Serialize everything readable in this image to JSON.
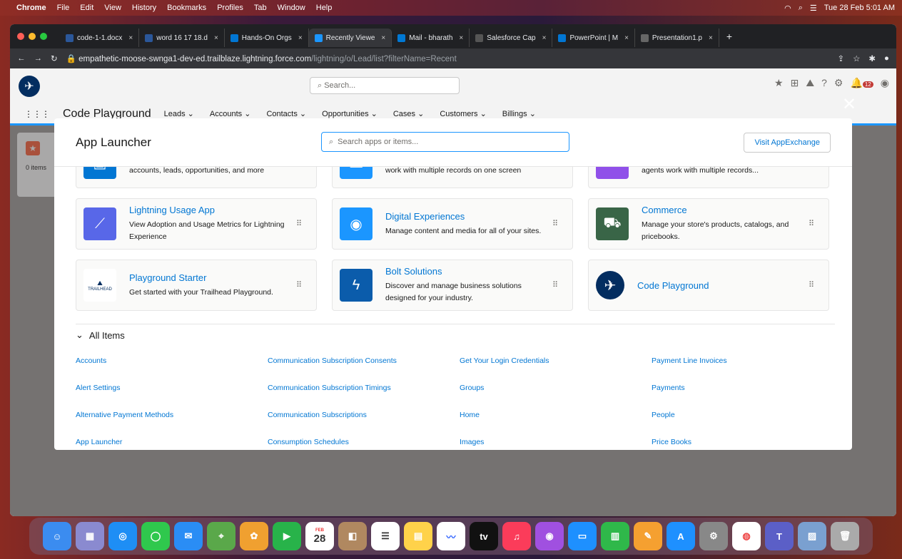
{
  "menubar": {
    "app": "Chrome",
    "items": [
      "File",
      "Edit",
      "View",
      "History",
      "Bookmarks",
      "Profiles",
      "Tab",
      "Window",
      "Help"
    ],
    "clock": "Tue 28 Feb  5:01 AM"
  },
  "tabs": [
    {
      "label": "code-1-1.docx",
      "color": "#2b579a"
    },
    {
      "label": "word 16 17 18.d",
      "color": "#2b579a"
    },
    {
      "label": "Hands-On Orgs",
      "color": "#0176d3"
    },
    {
      "label": "Recently Viewe",
      "color": "#1b96ff",
      "active": true
    },
    {
      "label": "Mail - bharath",
      "color": "#0078d4"
    },
    {
      "label": "Salesforce Cap",
      "color": "#555"
    },
    {
      "label": "PowerPoint | M",
      "color": "#0176d3"
    },
    {
      "label": "Presentation1.p",
      "color": "#666"
    }
  ],
  "address": {
    "host": "empathetic-moose-swnga1-dev-ed.trailblaze.lightning.force.com",
    "path": "/lightning/o/Lead/list?filterName=Recent"
  },
  "sf": {
    "search_placeholder": "Search...",
    "app_name": "Code Playground",
    "nav": [
      "Leads",
      "Accounts",
      "Contacts",
      "Opportunities",
      "Cases",
      "Customers",
      "Billings"
    ],
    "notif_count": "12"
  },
  "modal": {
    "title": "App Launcher",
    "search_placeholder": "Search apps or items...",
    "appexchange": "Visit AppExchange",
    "cards": [
      {
        "title": "",
        "desc": "accounts, leads, opportunities, and more",
        "color": "#0176d3",
        "icon": "bolt-icon"
      },
      {
        "title": "",
        "desc": "work with multiple records on one screen",
        "color": "#1b96ff",
        "icon": "cloud-icon"
      },
      {
        "title": "",
        "desc": "agents work with multiple records...",
        "color": "#9050e9",
        "icon": "console-icon"
      },
      {
        "title": "Lightning Usage App",
        "desc": "View Adoption and Usage Metrics for Lightning Experience",
        "color": "#5867e8",
        "icon": "chart-icon"
      },
      {
        "title": "Digital Experiences",
        "desc": "Manage content and media for all of your sites.",
        "color": "#1b96ff",
        "icon": "experience-icon"
      },
      {
        "title": "Commerce",
        "desc": "Manage your store's products, catalogs, and pricebooks.",
        "color": "#396547",
        "icon": "cart-icon"
      },
      {
        "title": "Playground Starter",
        "desc": "Get started with your Trailhead Playground.",
        "color": "#ffffff",
        "icon": "trailhead-icon"
      },
      {
        "title": "Bolt Solutions",
        "desc": "Discover and manage business solutions designed for your industry.",
        "color": "#0b5cab",
        "icon": "bolt-icon"
      },
      {
        "title": "Code Playground",
        "desc": "",
        "color": "#032d60",
        "icon": "plane-icon"
      }
    ],
    "all_items_label": "All Items",
    "all_items": [
      [
        "Accounts",
        "Alert Settings",
        "Alternative Payment Methods",
        "App Launcher"
      ],
      [
        "Communication Subscription Consents",
        "Communication Subscription Timings",
        "Communication Subscriptions",
        "Consumption Schedules"
      ],
      [
        "Get Your Login Credentials",
        "Groups",
        "Home",
        "Images"
      ],
      [
        "Payment Line Invoices",
        "Payments",
        "People",
        "Price Books"
      ]
    ]
  },
  "left_panel": {
    "items_text": "0 items"
  },
  "dock_apps": [
    "Finder",
    "Launchpad",
    "Safari",
    "Messages",
    "Mail",
    "Maps",
    "Photos",
    "FaceTime",
    "Calendar",
    "Contacts",
    "Reminders",
    "Notes",
    "Freeform",
    "TV",
    "Music",
    "Podcasts",
    "Keynote",
    "Numbers",
    "Pages",
    "App Store",
    "Settings",
    "Chrome",
    "Teams",
    "Preview",
    "Trash"
  ],
  "calendar_day": "28",
  "calendar_month": "FEB"
}
